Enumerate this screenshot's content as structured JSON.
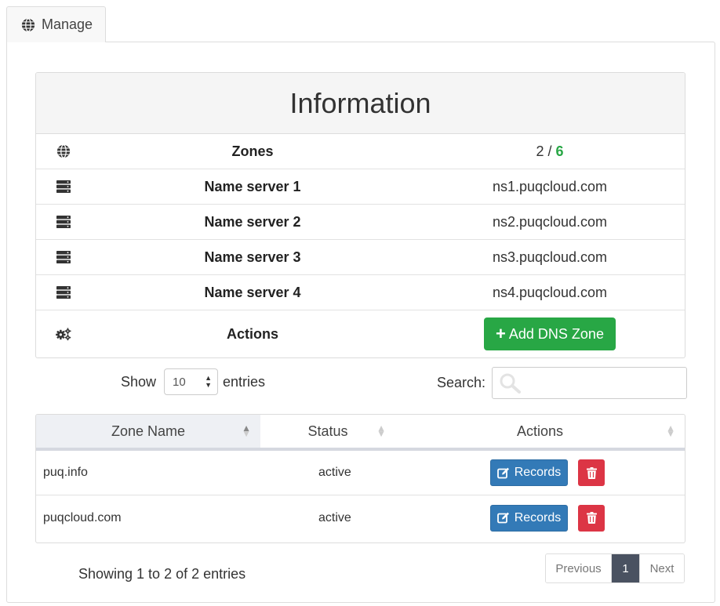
{
  "tab": {
    "label": "Manage",
    "icon": "globe-icon"
  },
  "info": {
    "title": "Information",
    "rows": [
      {
        "icon": "globe-icon",
        "label": "Zones",
        "used": "2",
        "sep": " / ",
        "limit": "6"
      },
      {
        "icon": "server-icon",
        "label": "Name server 1",
        "value": "ns1.puqcloud.com"
      },
      {
        "icon": "server-icon",
        "label": "Name server 2",
        "value": "ns2.puqcloud.com"
      },
      {
        "icon": "server-icon",
        "label": "Name server 3",
        "value": "ns3.puqcloud.com"
      },
      {
        "icon": "server-icon",
        "label": "Name server 4",
        "value": "ns4.puqcloud.com"
      }
    ],
    "actions": {
      "icon": "gears-icon",
      "label": "Actions",
      "add_button": "Add DNS Zone"
    }
  },
  "controls": {
    "show_label": "Show",
    "entries_label": "entries",
    "page_length": "10",
    "search_label": "Search:",
    "search_value": ""
  },
  "table": {
    "columns": [
      "Zone Name",
      "Status",
      "Actions"
    ],
    "rows": [
      {
        "zone": "puq.info",
        "status": "active",
        "records_label": "Records"
      },
      {
        "zone": "puqcloud.com",
        "status": "active",
        "records_label": "Records"
      }
    ]
  },
  "footer": {
    "summary": "Showing 1 to 2 of 2 entries",
    "pagination": {
      "previous": "Previous",
      "current": "1",
      "next": "Next"
    }
  },
  "colors": {
    "add_button": "#28a745",
    "records_button": "#337ab7",
    "delete_button": "#dc3545",
    "active_page": "#4a5261",
    "zone_limit": "#28a745"
  }
}
